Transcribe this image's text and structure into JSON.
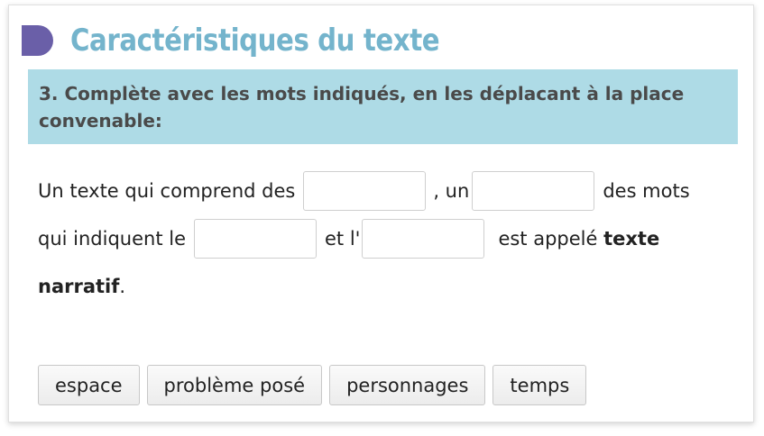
{
  "header": {
    "title": "Caractéristiques du texte"
  },
  "instruction": "3. Complète avec les mots indiqués, en les déplacant à la place convenable:",
  "exercise": {
    "line1_part1": "Un texte qui comprend des",
    "line1_part2": ", un",
    "line1_part3": "des mots",
    "line2_part1": "qui indiquent le",
    "line2_part2": "et l'",
    "line2_part3": "est appelé",
    "bold_part1": "texte",
    "bold_part2": "narratif",
    "line3_end": "."
  },
  "choices": [
    "espace",
    "problème posé",
    "personnages",
    "temps"
  ],
  "colors": {
    "title": "#74b4cc",
    "icon": "#6a5fa8",
    "instruction_bg": "#aedbe6"
  }
}
